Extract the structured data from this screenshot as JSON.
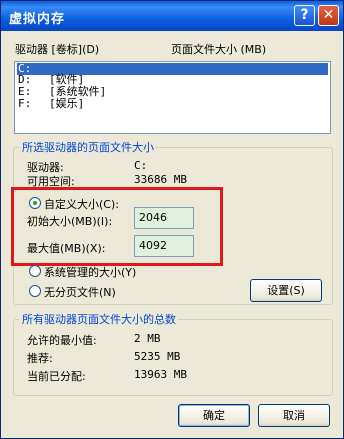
{
  "title": "虚拟内存",
  "help_glyph": "?",
  "close_glyph": "✕",
  "header": {
    "drive_col": "驱动器 [卷标](D)",
    "size_col": "页面文件大小 (MB)"
  },
  "drives": [
    {
      "letter": "C:",
      "label": "",
      "selected": true
    },
    {
      "letter": "D:",
      "label": "[软件]",
      "selected": false
    },
    {
      "letter": "E:",
      "label": "[系统软件]",
      "selected": false
    },
    {
      "letter": "F:",
      "label": "[娱乐]",
      "selected": false
    }
  ],
  "selected_drive": {
    "legend": "所选驱动器的页面文件大小",
    "drive_label": "驱动器:",
    "drive_value": "C:",
    "space_label": "可用空间:",
    "space_value": "33686 MB",
    "custom_label": "自定义大小(C):",
    "initial_label": "初始大小(MB)(I):",
    "initial_value": "2046",
    "max_label": "最大值(MB)(X):",
    "max_value": "4092",
    "system_label": "系统管理的大小(Y)",
    "nopaging_label": "无分页文件(N)",
    "set_button": "设置(S)"
  },
  "total": {
    "legend": "所有驱动器页面文件大小的总数",
    "min_label": "允许的最小值:",
    "min_value": "2 MB",
    "rec_label": "推荐:",
    "rec_value": "5235 MB",
    "cur_label": "当前已分配:",
    "cur_value": "13963 MB"
  },
  "ok_button": "确定",
  "cancel_button": "取消"
}
